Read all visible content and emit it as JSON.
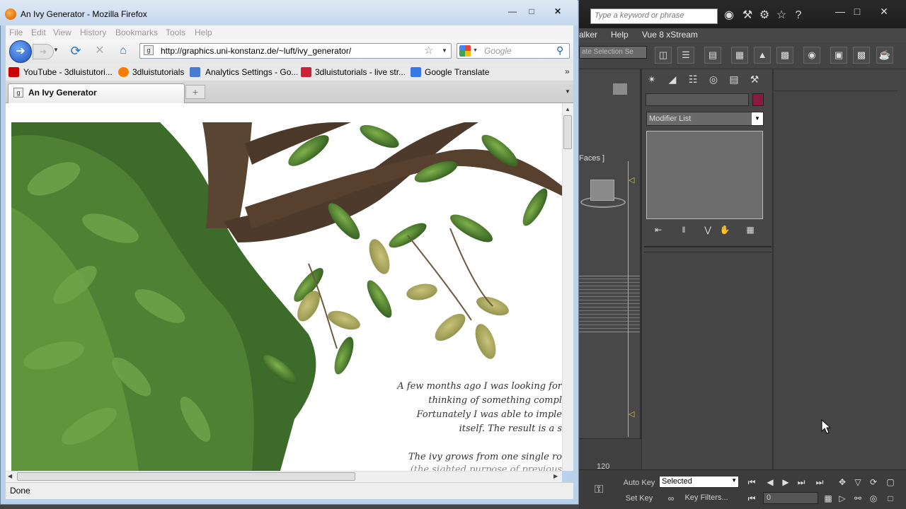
{
  "max": {
    "search_placeholder": "Type a keyword or phrase",
    "menu": [
      "alker",
      "Help",
      "Vue 8 xStream"
    ],
    "selection_set": "ate Selection Se",
    "viewport_label": "Faces ]",
    "timeline_frame": "120",
    "modifier_list": "Modifier List",
    "auto_key": "Auto Key",
    "set_key": "Set Key",
    "selected_option": "Selected",
    "key_filters": "Key Filters...",
    "current_frame": "0"
  },
  "firefox": {
    "window_title": "An Ivy Generator - Mozilla Firefox",
    "menu": [
      "File",
      "Edit",
      "View",
      "History",
      "Bookmarks",
      "Tools",
      "Help"
    ],
    "url": "http://graphics.uni-konstanz.de/~luft/ivy_generator/",
    "search_placeholder": "Google",
    "bookmarks": [
      {
        "label": "YouTube - 3dluistutori...",
        "color": "#cc0000"
      },
      {
        "label": "3dluistutorials",
        "color": "#f57d00"
      },
      {
        "label": "Analytics Settings - Go...",
        "color": "#4a7bd3"
      },
      {
        "label": "3dluistutorials - live str...",
        "color": "#cc2233"
      },
      {
        "label": "Google Translate",
        "color": "#3b78e7"
      }
    ],
    "tab_title": "An Ivy Generator",
    "status": "Done"
  },
  "page": {
    "intro_lines": [
      "A few months ago I was looking for",
      "thinking of something compl",
      "Fortunately I was able to imple",
      "itself. The result is a s",
      "",
      "The ivy grows from one single ro",
      "(the sighted purpose of previous"
    ]
  }
}
